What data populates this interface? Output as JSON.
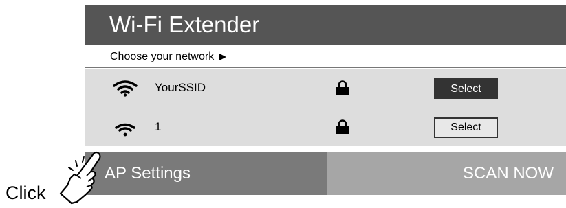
{
  "app": {
    "title": "Wi-Fi Extender",
    "subtitle": "Choose your network"
  },
  "networks": [
    {
      "ssid": "YourSSID",
      "icon": "wifi-icon",
      "lock_icon": "lock-icon",
      "select_label": "Select",
      "selected": true
    },
    {
      "ssid": "1",
      "icon": "wifi-icon",
      "lock_icon": "lock-icon",
      "select_label": "Select",
      "selected": false
    }
  ],
  "bottom_bar": {
    "ap_settings_label": "AP Settings",
    "scan_now_label": "SCAN NOW"
  },
  "callout": {
    "click_label": "Click",
    "icon": "pointing-hand-icon"
  },
  "colors": {
    "titlebar": "#555555",
    "row_background": "#dddddd",
    "ap_settings_bg": "#7a7a7a",
    "scan_now_bg": "#a6a6a6",
    "selected_button": "#333333"
  }
}
